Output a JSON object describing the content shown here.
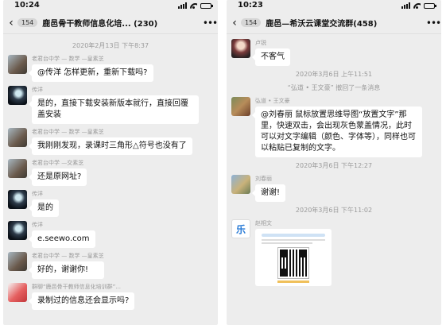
{
  "left": {
    "status": {
      "time": "10:24"
    },
    "nav": {
      "unread": "154",
      "title": "鹿邑骨干教师信息化培...",
      "count": "(230)"
    },
    "timestamp": "2020年2月13日 下午8:37",
    "messages": [
      {
        "sender": "老君台中学 — 数学 —皇素芝",
        "text": "@传洋 怎样更新，重新下载吗?"
      },
      {
        "sender": "传洋",
        "text": "是的，直接下载安装新版本就行，直接回覆盖安装"
      },
      {
        "sender": "老君台中学 — 数学 —皇素芝",
        "text": "我刚刚发现，录课时三角形△符号也没有了"
      },
      {
        "sender": "老君台中学 —交素芝",
        "text": "还是原网址?"
      },
      {
        "sender": "传洋",
        "text": "是的"
      },
      {
        "sender": "传洋",
        "text": "e.seewo.com"
      },
      {
        "sender": "老君台中学 — 数学 —皇素芝",
        "text": "好的，谢谢你!"
      },
      {
        "sender": "群聊“鹿邑骨干教师信息化培训群”...",
        "text": "录制过的信息还会显示吗?"
      }
    ]
  },
  "right": {
    "status": {
      "time": "10:23"
    },
    "nav": {
      "unread": "154",
      "title": "鹿邑—希沃云课堂交流群",
      "count": "(458)"
    },
    "messages": [
      {
        "sender": "卢锐",
        "text": "不客气"
      },
      {
        "timestamp": "2020年3月6日 上午11:51"
      },
      {
        "system": "“弘道 • 王文豪” 撤回了一条消息"
      },
      {
        "sender": "弘道 • 王文豪",
        "text": "@刘春丽 鼠标放置思维导图“放置文字”那里，快速双击，会出现灰色蒙盖情况，此时可以对文字编辑（颜色、字体等），同样也可以粘贴已复制的文字。"
      },
      {
        "timestamp": "2020年3月6日 下午12:27"
      },
      {
        "sender": "刘春丽",
        "text": "谢谢!"
      },
      {
        "timestamp": "2020年3月6日 下午11:02"
      },
      {
        "sender": "赵相文",
        "image": "qr-card"
      }
    ],
    "avatar_label": "乐"
  }
}
